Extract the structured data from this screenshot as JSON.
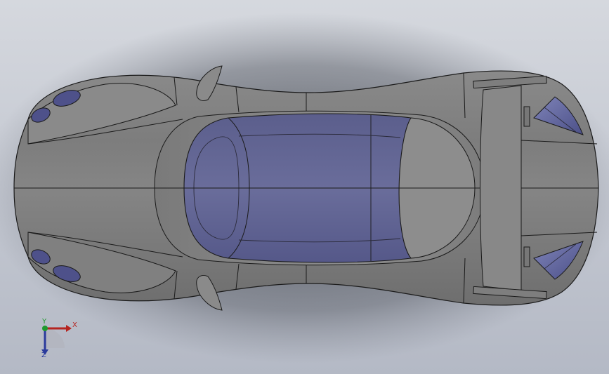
{
  "view": {
    "title": "",
    "background_top": "#d5d8de",
    "background_bottom": "#b4b9c5",
    "body_color": "#7c7c7c",
    "glass_color": "#5c5f8f",
    "edge_color": "#1a1a1a"
  },
  "model": {
    "name": "",
    "parts": [
      "body",
      "canopy-glass",
      "rear-wing",
      "mirrors",
      "headlights",
      "tail-lights",
      "wheel-arches"
    ]
  },
  "triad": {
    "x_label": "X",
    "y_label": "Y",
    "z_label": "Z",
    "x_color": "#b5241f",
    "y_color": "#1f9a2e",
    "z_color": "#2a3a9c"
  }
}
